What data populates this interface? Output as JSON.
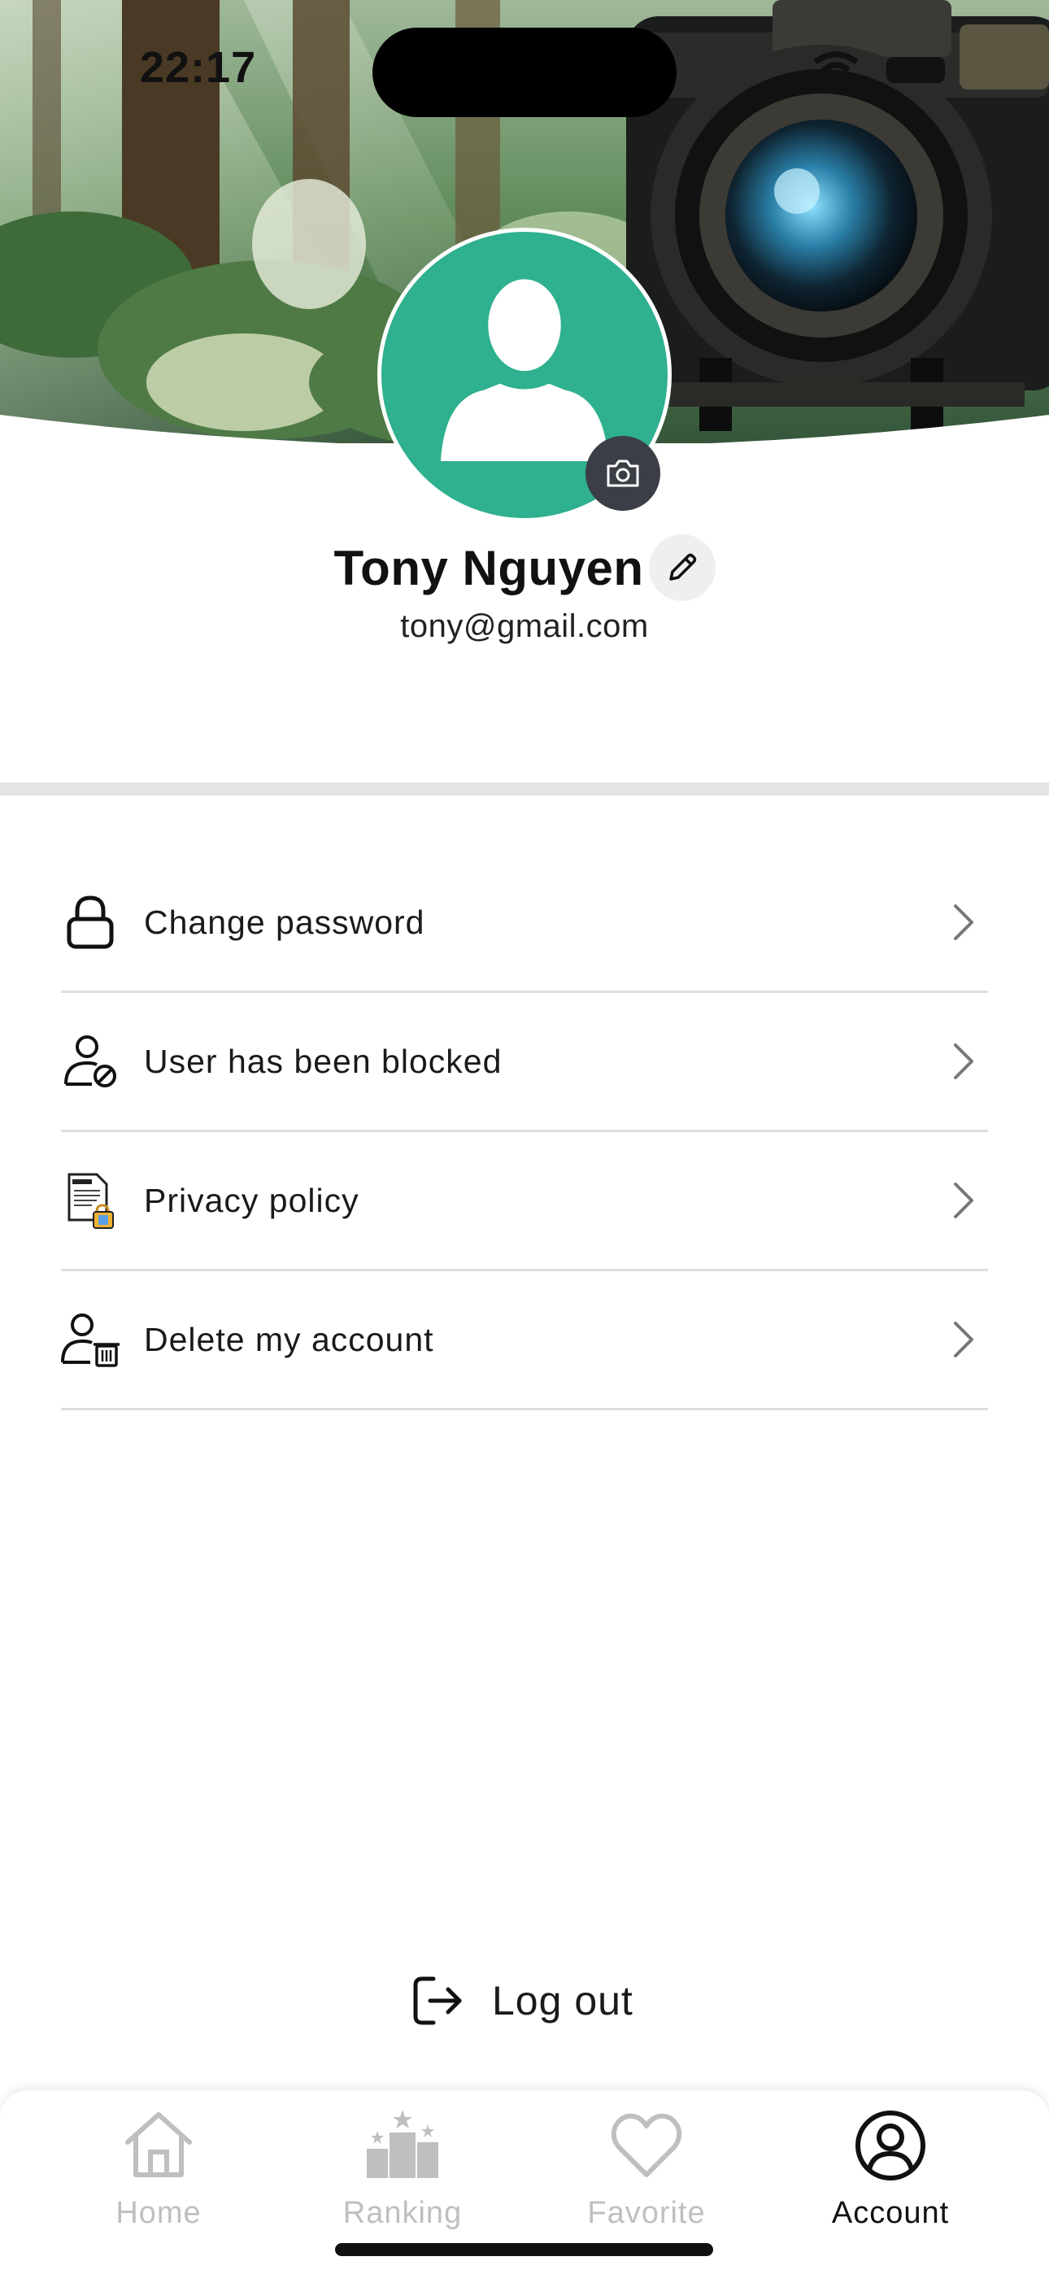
{
  "status_bar": {
    "time": "22:17",
    "icons": [
      "wifi-icon",
      "battery-icon"
    ]
  },
  "profile": {
    "name": "Tony Nguyen",
    "email": "tony@gmail.com",
    "avatar_color": "#2fb08e",
    "cover_image": "forest-camera-cover"
  },
  "menu": {
    "items": [
      {
        "label": "Change password",
        "icon": "lock-icon"
      },
      {
        "label": "User has been blocked",
        "icon": "user-blocked-icon"
      },
      {
        "label": "Privacy policy",
        "icon": "privacy-policy-icon"
      },
      {
        "label": "Delete my account",
        "icon": "delete-account-icon"
      }
    ]
  },
  "logout": {
    "label": "Log out"
  },
  "tabbar": {
    "tabs": [
      {
        "label": "Home",
        "icon": "home-icon",
        "active": false
      },
      {
        "label": "Ranking",
        "icon": "ranking-icon",
        "active": false
      },
      {
        "label": "Favorite",
        "icon": "heart-icon",
        "active": false
      },
      {
        "label": "Account",
        "icon": "account-icon",
        "active": true
      }
    ]
  },
  "colors": {
    "accent": "#2fb08e",
    "inactive_tab": "#bfbfbf",
    "active_tab": "#111111"
  }
}
